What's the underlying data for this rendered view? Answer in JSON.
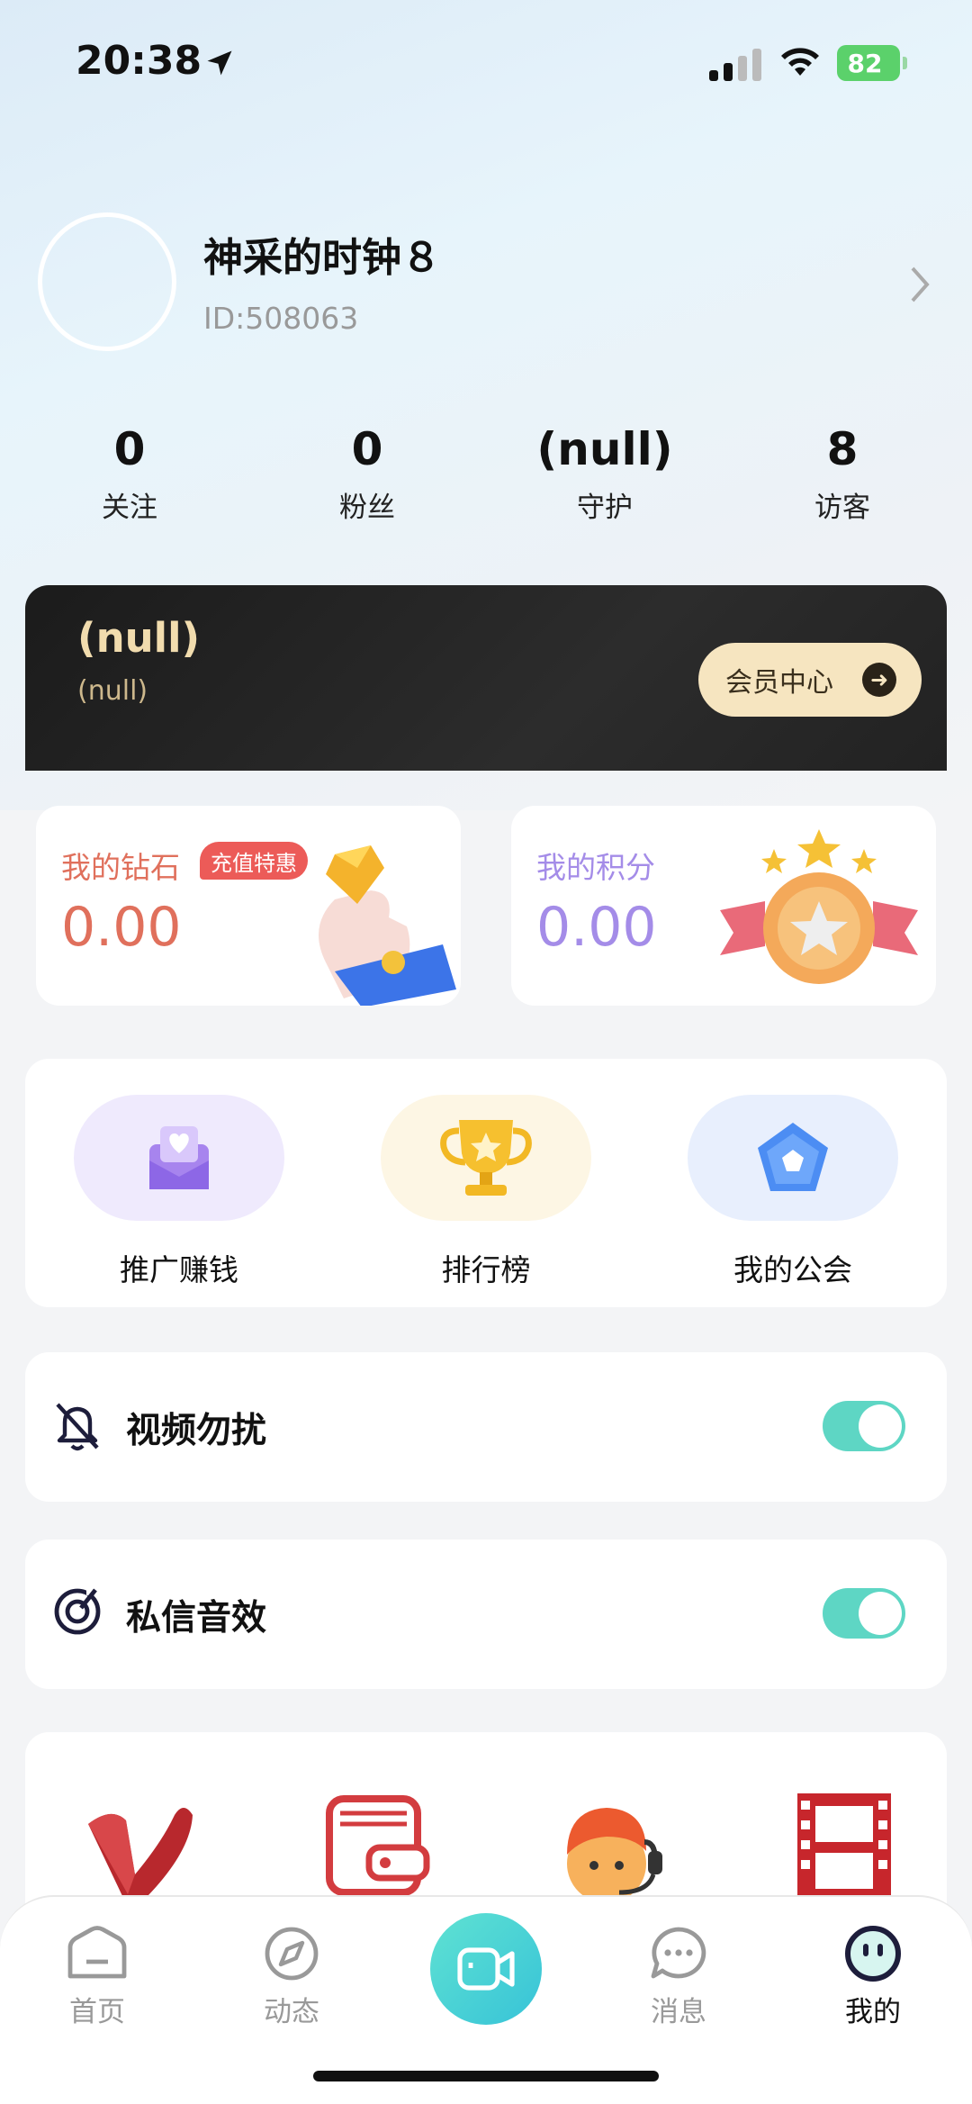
{
  "status_bar": {
    "time": "20:38",
    "battery": "82"
  },
  "profile": {
    "nickname": "神采的时钟８",
    "id_text": "ID:508063"
  },
  "stats": [
    {
      "value": "0",
      "label": "关注"
    },
    {
      "value": "0",
      "label": "粉丝"
    },
    {
      "value": "(null)",
      "label": "守护"
    },
    {
      "value": "8",
      "label": "访客"
    }
  ],
  "vip": {
    "title": "(null)",
    "subtitle": "(null)",
    "button": "会员中心"
  },
  "wallet": {
    "diamonds": {
      "title": "我的钻石",
      "tag": "充值特惠",
      "value": "0.00"
    },
    "points": {
      "title": "我的积分",
      "value": "0.00"
    }
  },
  "features": [
    {
      "label": "推广赚钱",
      "icon": "mail-heart-icon"
    },
    {
      "label": "排行榜",
      "icon": "trophy-icon"
    },
    {
      "label": "我的公会",
      "icon": "guild-shield-icon"
    }
  ],
  "settings": [
    {
      "label": "视频勿扰",
      "icon": "bell-off-icon",
      "on": true
    },
    {
      "label": "私信音效",
      "icon": "sound-icon",
      "on": true
    }
  ],
  "services": [
    "vip-icon",
    "wallet-icon",
    "customer-service-icon",
    "film-icon"
  ],
  "tabbar": [
    {
      "label": "首页",
      "icon": "home-icon"
    },
    {
      "label": "动态",
      "icon": "compass-icon"
    },
    {
      "label": "",
      "icon": "video-camera-icon"
    },
    {
      "label": "消息",
      "icon": "chat-icon"
    },
    {
      "label": "我的",
      "icon": "profile-face-icon",
      "active": true
    }
  ],
  "colors": {
    "accent": "#5ed6c4",
    "diamond_text": "#e0705c",
    "points_text": "#a48ce8",
    "vip_gold": "#f1dcae"
  }
}
